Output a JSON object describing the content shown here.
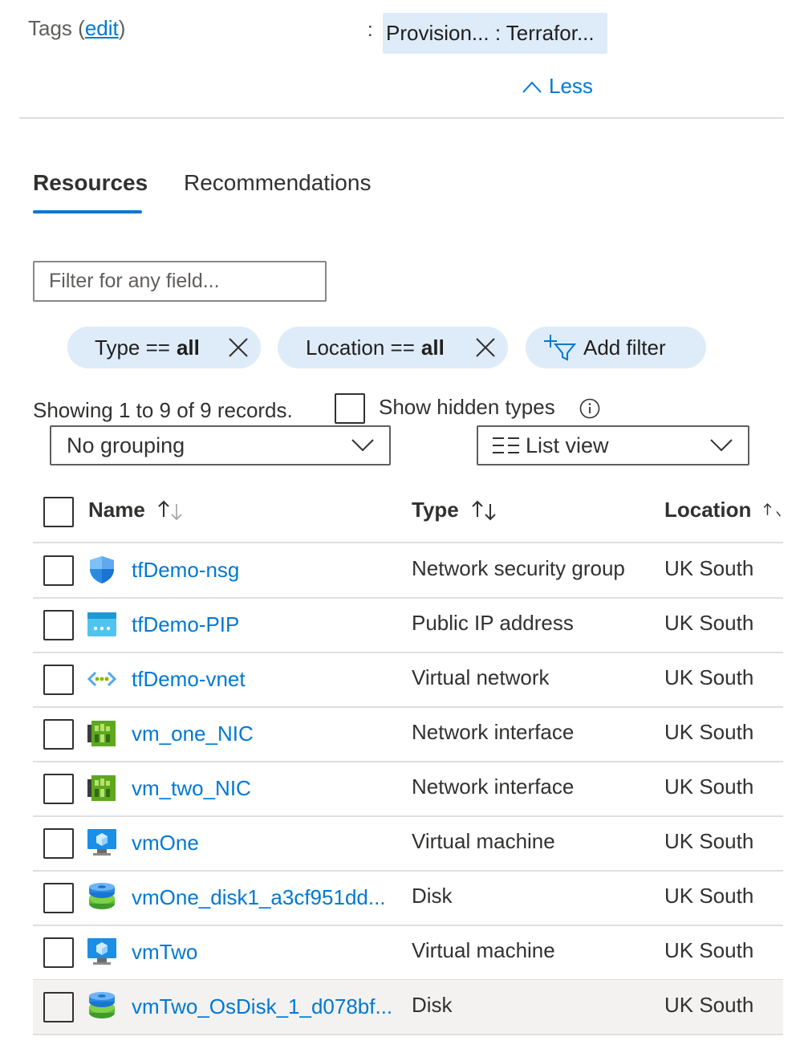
{
  "tags": {
    "label": "Tags",
    "edit_link": "edit",
    "colon": ":",
    "chip_text": "Provision... : Terrafor...",
    "less_label": "Less"
  },
  "tabs": [
    {
      "label": "Resources",
      "active": true
    },
    {
      "label": "Recommendations",
      "active": false
    }
  ],
  "filter": {
    "placeholder": "Filter for any field..."
  },
  "pills": {
    "type": {
      "key": "Type == ",
      "value": "all"
    },
    "location": {
      "key": "Location == ",
      "value": "all"
    },
    "add_filter": "Add filter"
  },
  "records_text": "Showing 1 to 9 of 9 records.",
  "show_hidden_label": "Show hidden types",
  "grouping": {
    "selected": "No grouping"
  },
  "view": {
    "selected": "List view"
  },
  "columns": {
    "name": "Name",
    "type": "Type",
    "location": "Location"
  },
  "rows": [
    {
      "name": "tfDemo-nsg",
      "type": "Network security group",
      "location": "UK South",
      "icon": "nsg-icon"
    },
    {
      "name": "tfDemo-PIP",
      "type": "Public IP address",
      "location": "UK South",
      "icon": "public-ip-icon"
    },
    {
      "name": "tfDemo-vnet",
      "type": "Virtual network",
      "location": "UK South",
      "icon": "vnet-icon"
    },
    {
      "name": "vm_one_NIC",
      "type": "Network interface",
      "location": "UK South",
      "icon": "nic-icon"
    },
    {
      "name": "vm_two_NIC",
      "type": "Network interface",
      "location": "UK South",
      "icon": "nic-icon"
    },
    {
      "name": "vmOne",
      "type": "Virtual machine",
      "location": "UK South",
      "icon": "vm-icon"
    },
    {
      "name": "vmOne_disk1_a3cf951dd...",
      "type": "Disk",
      "location": "UK South",
      "icon": "disk-icon"
    },
    {
      "name": "vmTwo",
      "type": "Virtual machine",
      "location": "UK South",
      "icon": "vm-icon"
    },
    {
      "name": "vmTwo_OsDisk_1_d078bf...",
      "type": "Disk",
      "location": "UK South",
      "icon": "disk-icon"
    }
  ],
  "colors": {
    "accent": "#0078d4",
    "pill": "#deecf9",
    "selected_row": "#f3f2f1"
  }
}
